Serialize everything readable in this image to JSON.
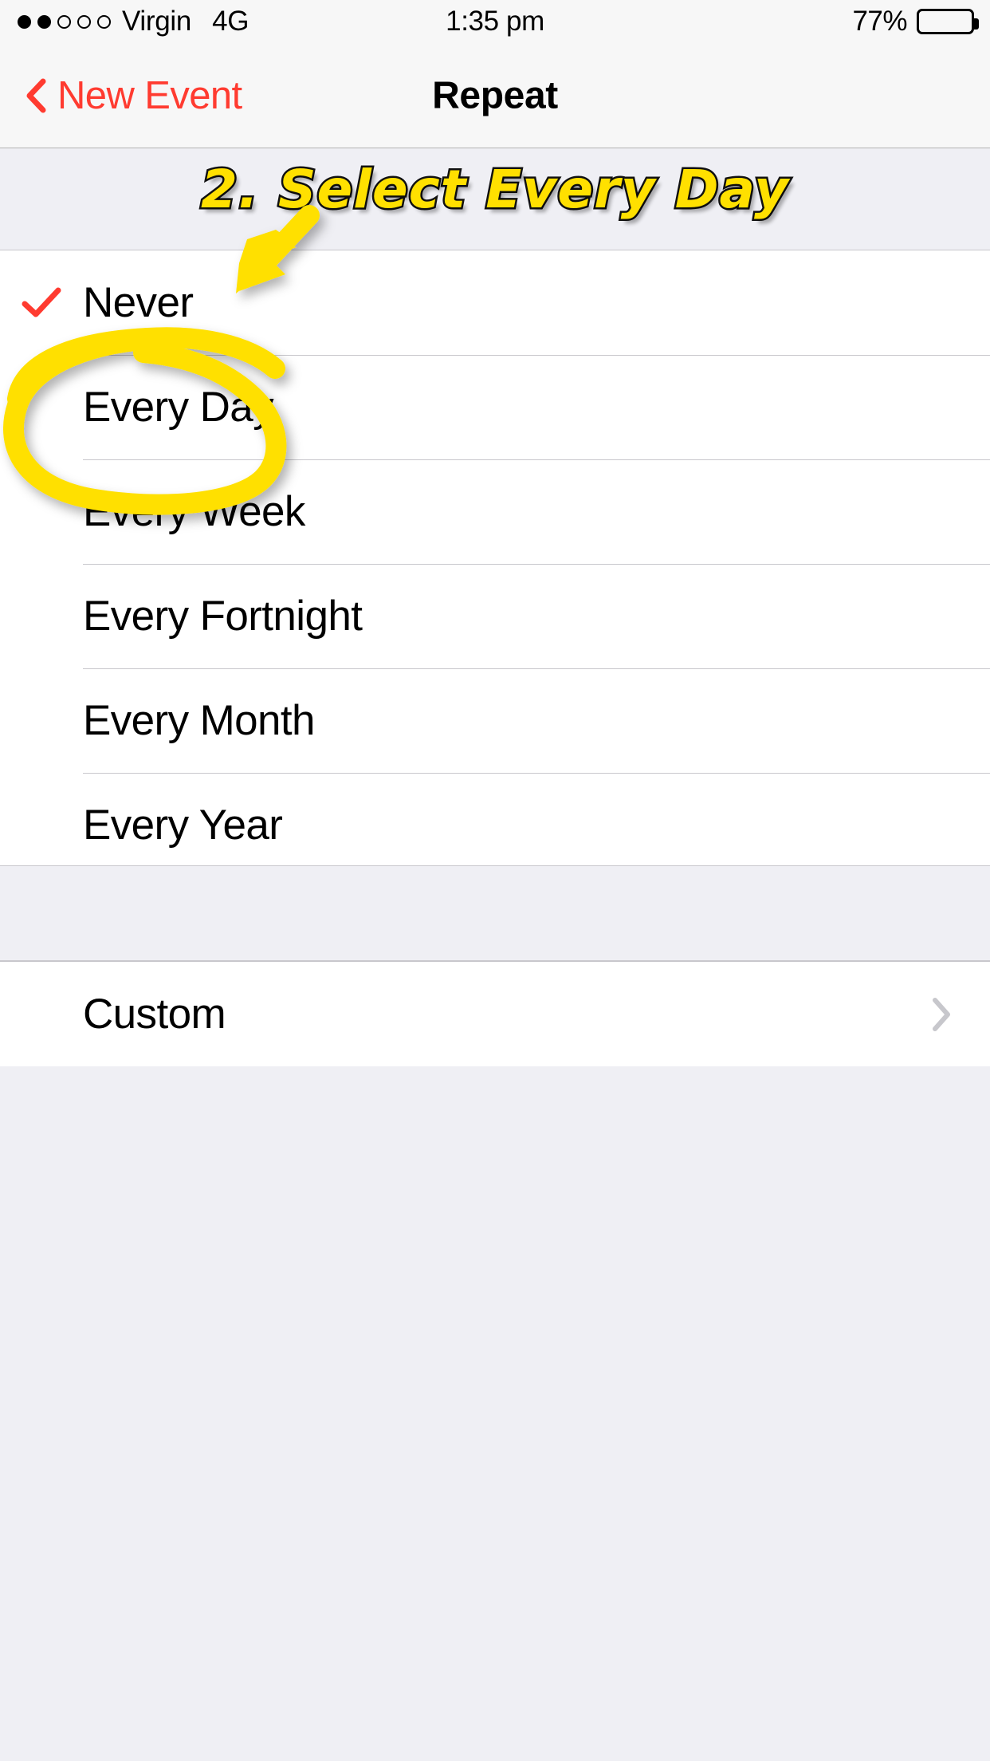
{
  "status_bar": {
    "signal_dots_total": 5,
    "signal_dots_filled": 2,
    "carrier": "Virgin",
    "network_type": "4G",
    "time": "1:35 pm",
    "battery_percent": "77%",
    "battery_level": 77
  },
  "nav_bar": {
    "back_label": "New Event",
    "title": "Repeat",
    "back_color": "#FF3B30"
  },
  "annotation": {
    "text": "2. Select Every Day",
    "fill_color": "#FFE000",
    "stroke_color": "#111111",
    "circled_item": "Every Day"
  },
  "list": {
    "sections": [
      {
        "name": "repeat-options",
        "rows": [
          {
            "label": "Never",
            "checked": true,
            "chevron": false
          },
          {
            "label": "Every Day",
            "checked": false,
            "chevron": false
          },
          {
            "label": "Every Week",
            "checked": false,
            "chevron": false
          },
          {
            "label": "Every Fortnight",
            "checked": false,
            "chevron": false
          },
          {
            "label": "Every Month",
            "checked": false,
            "chevron": false
          },
          {
            "label": "Every Year",
            "checked": false,
            "chevron": false
          }
        ]
      },
      {
        "name": "custom-section",
        "rows": [
          {
            "label": "Custom",
            "checked": false,
            "chevron": true
          }
        ]
      }
    ],
    "selected_value": "Never",
    "checkmark_color": "#FF3B30"
  },
  "icons": {
    "back_chevron": "chevron-left-icon",
    "disclosure_chevron": "chevron-right-icon",
    "checkmark": "checkmark-icon",
    "battery": "battery-icon",
    "signal": "signal-dots-icon"
  }
}
